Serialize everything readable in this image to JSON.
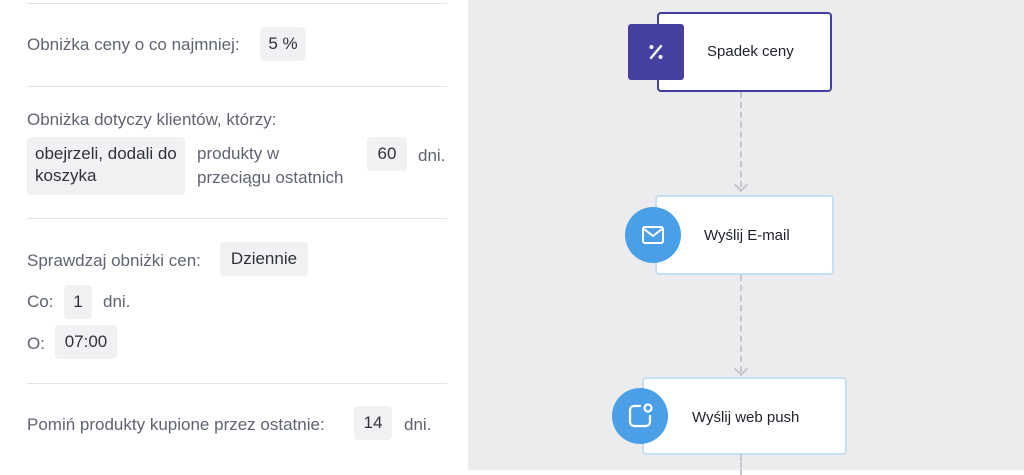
{
  "settings": {
    "discount_label": "Obniżka ceny o co najmniej:",
    "discount_value": "5 %",
    "applies_label": "Obniżka dotyczy klientów, którzy:",
    "behavior_value": "obejrzeli, dodali do koszyka",
    "products_within_label": "produkty w przeciągu ostatnich",
    "days_value": "60",
    "days_unit": "dni.",
    "check_label": "Sprawdzaj obniżki cen:",
    "check_value": "Dziennie",
    "every_label": "Co:",
    "every_value": "1",
    "every_unit": "dni.",
    "at_label": "O:",
    "at_value": "07:00",
    "skip_label": "Pomiń produkty kupione przez ostatnie:",
    "skip_value": "14",
    "skip_unit": "dni."
  },
  "workflow": {
    "nodes": [
      {
        "title": "Spadek ceny",
        "icon": "percent-icon"
      },
      {
        "title": "Wyślij E-mail",
        "icon": "mail-icon"
      },
      {
        "title": "Wyślij web push",
        "icon": "web-push-icon"
      }
    ],
    "colors": {
      "trigger": "#4340a0",
      "action": "#4b9fe6",
      "canvas": "#ececee"
    }
  }
}
